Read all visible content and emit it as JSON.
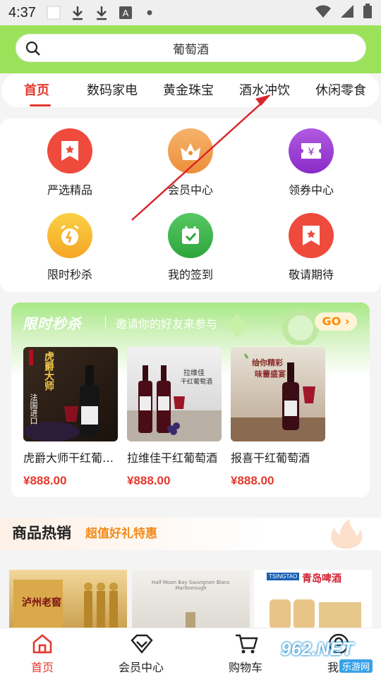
{
  "status_bar": {
    "time": "4:37"
  },
  "search": {
    "value": "葡萄酒"
  },
  "tabs": [
    "首页",
    "数码家电",
    "黄金珠宝",
    "酒水冲饮",
    "休闲零食"
  ],
  "grid": [
    {
      "label": "严选精品",
      "color": "#ef4b3c",
      "icon": "bookmark-star-icon"
    },
    {
      "label": "会员中心",
      "color": "#f59a3c",
      "icon": "crown-icon"
    },
    {
      "label": "领券中心",
      "color": "#9b39d6",
      "icon": "coupon-yen-icon"
    },
    {
      "label": "限时秒杀",
      "color": "#f7b728",
      "icon": "alarm-clock-icon"
    },
    {
      "label": "我的签到",
      "color": "#3bb549",
      "icon": "calendar-check-icon"
    },
    {
      "label": "敬请期待",
      "color": "#ef4b3c",
      "icon": "bookmark-star-icon"
    }
  ],
  "flash_sale": {
    "title": "限时秒杀",
    "subtitle": "邀请你的好友来参与",
    "go_label": "GO",
    "products": [
      {
        "name": "虎爵大师干红葡萄酒",
        "price": "¥888.00",
        "img_text": [
          "虎爵大师",
          "法国进口"
        ]
      },
      {
        "name": "拉维佳干红葡萄酒",
        "price": "¥888.00",
        "img_text": [
          "拉维佳",
          "干红葡萄酒"
        ]
      },
      {
        "name": "报喜干红葡萄酒",
        "price": "¥888.00",
        "img_text": [
          "给你精彩",
          "味蕾盛宴"
        ]
      }
    ]
  },
  "hot_sale": {
    "title": "商品热销",
    "subtitle": "超值好礼特惠"
  },
  "bottom_products": [
    {
      "text": "泸州老窖"
    },
    {
      "text": "Half Moon Bay Sauvignon Blanc Marlborough"
    },
    {
      "text": "青岛啤酒",
      "brand": "TSINGTAO"
    }
  ],
  "bottom_nav": [
    "首页",
    "会员中心",
    "购物车",
    "我的"
  ],
  "watermark": {
    "text": "962.NET",
    "sub": "乐游网"
  }
}
